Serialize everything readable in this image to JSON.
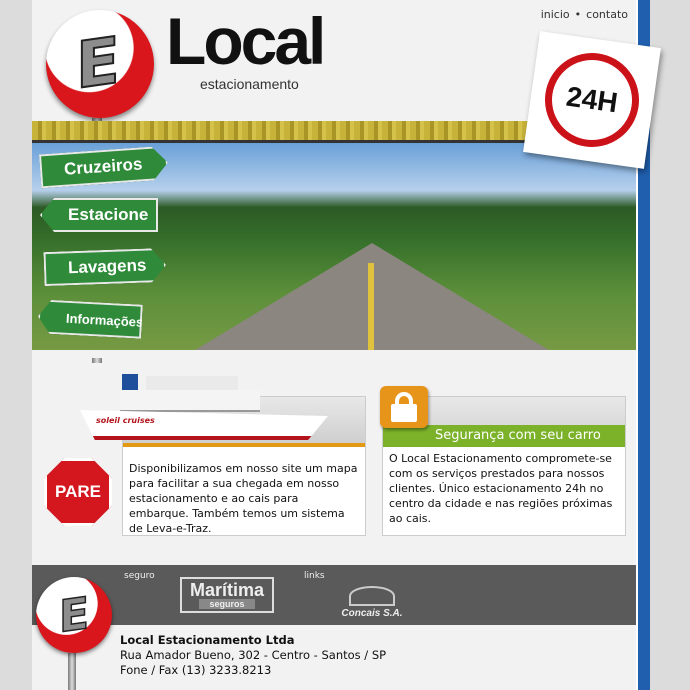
{
  "topnav": {
    "home": "inicio",
    "separator": "•",
    "contact": "contato"
  },
  "brand": {
    "logo_letter": "E",
    "name": "Local",
    "tagline": "estacionamento"
  },
  "badge": {
    "text": "24H"
  },
  "nav_signs": [
    {
      "label": "Cruzeiros",
      "direction": "right"
    },
    {
      "label": "Estacione",
      "direction": "left"
    },
    {
      "label": "Lavagens",
      "direction": "right"
    },
    {
      "label": "Informações",
      "direction": "left"
    }
  ],
  "ship": {
    "brand": "soleil cruises"
  },
  "left_box": {
    "text": "Disponibilizamos em nosso site um mapa para facilitar a sua chegada em nosso estacionamento e ao cais para embarque. Também temos um sistema de Leva-e-Traz."
  },
  "stop_sign": {
    "text": "PARE"
  },
  "right_box": {
    "title": "Segurança com seu carro",
    "text": "O Local Estacionamento compromete-se com os serviços prestados para nossos clientes. Único estacionamento 24h no centro da cidade e nas regiões próximas ao cais."
  },
  "footer": {
    "label_seguro": "seguro",
    "label_links": "links",
    "partner1": {
      "name": "Marítima",
      "sub": "seguros"
    },
    "partner2": {
      "name": "Concais S.A."
    },
    "company": "Local Estacionamento Ltda",
    "address": "Rua Amador Bueno, 302 - Centro - Santos / SP",
    "phone": "Fone / Fax (13) 3233.8213"
  },
  "colors": {
    "accent_blue": "#1f5fae",
    "sign_green": "#2f8b3a",
    "stop_red": "#d4171e",
    "box_green": "#7bb22a",
    "box_orange": "#e39a12"
  }
}
